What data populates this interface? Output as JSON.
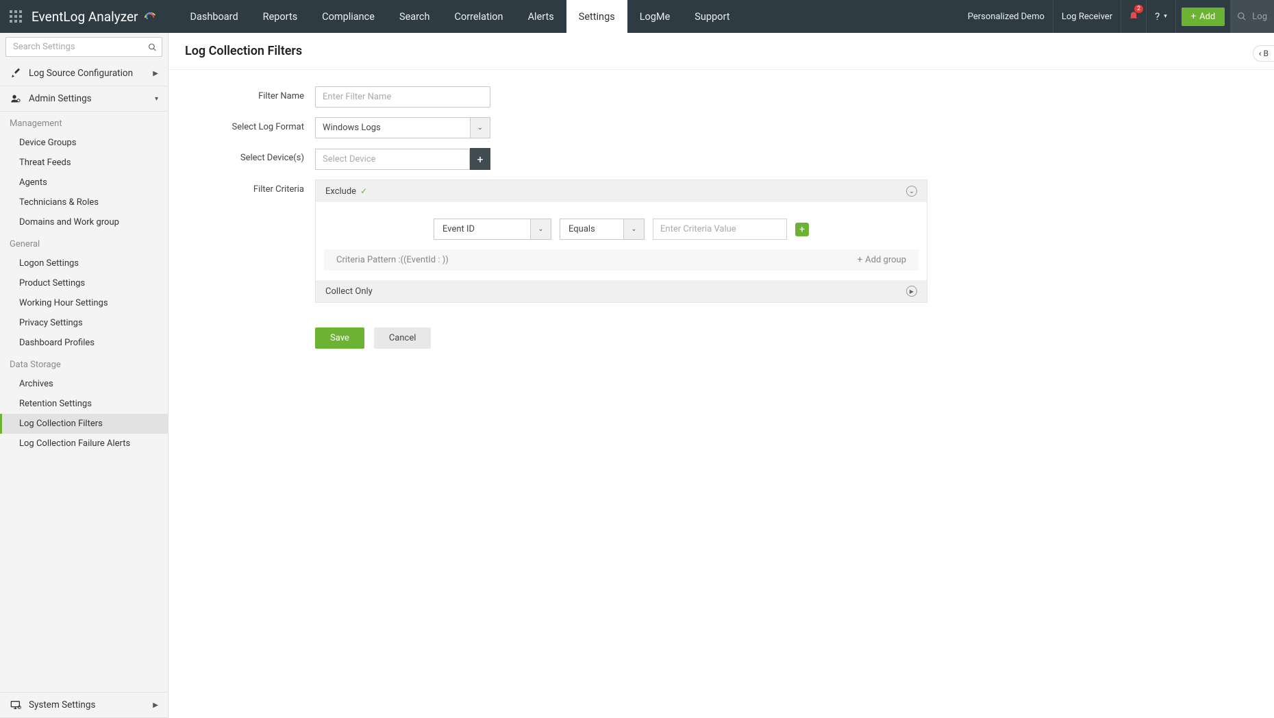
{
  "header": {
    "app_name": "EventLog Analyzer",
    "nav": [
      "Dashboard",
      "Reports",
      "Compliance",
      "Search",
      "Correlation",
      "Alerts",
      "Settings",
      "LogMe",
      "Support"
    ],
    "active_nav": "Settings",
    "top_links": {
      "demo": "Personalized Demo",
      "receiver": "Log Receiver"
    },
    "notif_count": "2",
    "help_label": "?",
    "add_btn": "Add",
    "search_placeholder": "Log"
  },
  "sidebar": {
    "search_placeholder": "Search Settings",
    "sections": {
      "log_source": "Log Source Configuration",
      "admin": "Admin Settings",
      "system": "System Settings"
    },
    "groups": {
      "mgmt": "Management",
      "mgmt_items": [
        "Device Groups",
        "Threat Feeds",
        "Agents",
        "Technicians & Roles",
        "Domains and Work group"
      ],
      "general": "General",
      "general_items": [
        "Logon Settings",
        "Product Settings",
        "Working Hour Settings",
        "Privacy Settings",
        "Dashboard Profiles"
      ],
      "storage": "Data Storage",
      "storage_items": [
        "Archives",
        "Retention Settings",
        "Log Collection Filters",
        "Log Collection Failure Alerts"
      ]
    },
    "active_item": "Log Collection Filters"
  },
  "content": {
    "title": "Log Collection Filters",
    "back_label": "B",
    "form": {
      "filter_name_label": "Filter Name",
      "filter_name_placeholder": "Enter Filter Name",
      "log_format_label": "Select Log Format",
      "log_format_value": "Windows Logs",
      "device_label": "Select Device(s)",
      "device_placeholder": "Select Device",
      "criteria_label": "Filter Criteria",
      "exclude_label": "Exclude",
      "collect_only_label": "Collect Only",
      "criteria": {
        "field_value": "Event ID",
        "operator_value": "Equals",
        "value_placeholder": "Enter Criteria Value",
        "pattern_prefix": "Criteria Pattern : ",
        "pattern_value": "((EventId : ))",
        "add_group_label": "Add group"
      },
      "save_label": "Save",
      "cancel_label": "Cancel"
    }
  }
}
